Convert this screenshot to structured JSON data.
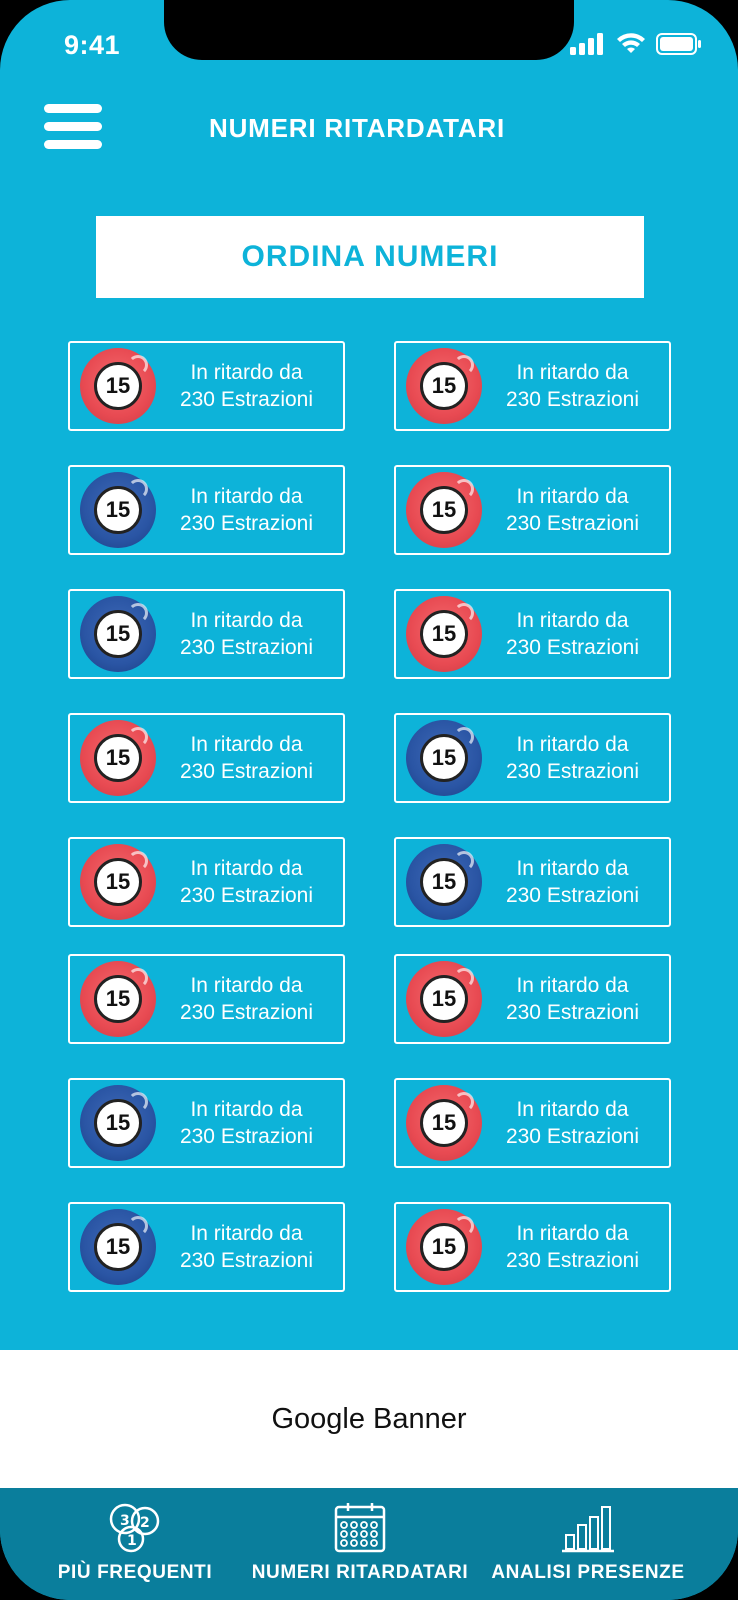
{
  "status_bar": {
    "time": "9:41"
  },
  "header": {
    "title": "NUMERI RITARDATARI"
  },
  "sort_button": {
    "label": "ORDINA NUMERI"
  },
  "cards": [
    {
      "number": "15",
      "line1": "In ritardo da",
      "line2": "230 Estrazioni",
      "ball_color": "#e84a52"
    },
    {
      "number": "15",
      "line1": "In ritardo da",
      "line2": "230 Estrazioni",
      "ball_color": "#e84a52"
    },
    {
      "number": "15",
      "line1": "In ritardo da",
      "line2": "230 Estrazioni",
      "ball_color": "#2a55a4"
    },
    {
      "number": "15",
      "line1": "In ritardo da",
      "line2": "230 Estrazioni",
      "ball_color": "#e84a52"
    },
    {
      "number": "15",
      "line1": "In ritardo da",
      "line2": "230 Estrazioni",
      "ball_color": "#2a55a4"
    },
    {
      "number": "15",
      "line1": "In ritardo da",
      "line2": "230 Estrazioni",
      "ball_color": "#e84a52"
    },
    {
      "number": "15",
      "line1": "In ritardo da",
      "line2": "230 Estrazioni",
      "ball_color": "#e84a52"
    },
    {
      "number": "15",
      "line1": "In ritardo da",
      "line2": "230 Estrazioni",
      "ball_color": "#2a55a4"
    },
    {
      "number": "15",
      "line1": "In ritardo da",
      "line2": "230 Estrazioni",
      "ball_color": "#e84a52"
    },
    {
      "number": "15",
      "line1": "In ritardo da",
      "line2": "230 Estrazioni",
      "ball_color": "#2a55a4"
    },
    {
      "number": "15",
      "line1": "In ritardo da",
      "line2": "230 Estrazioni",
      "ball_color": "#e84a52"
    },
    {
      "number": "15",
      "line1": "In ritardo da",
      "line2": "230 Estrazioni",
      "ball_color": "#e84a52"
    },
    {
      "number": "15",
      "line1": "In ritardo da",
      "line2": "230 Estrazioni",
      "ball_color": "#2a55a4"
    },
    {
      "number": "15",
      "line1": "In ritardo da",
      "line2": "230 Estrazioni",
      "ball_color": "#e84a52"
    },
    {
      "number": "15",
      "line1": "In ritardo da",
      "line2": "230 Estrazioni",
      "ball_color": "#2a55a4"
    },
    {
      "number": "15",
      "line1": "In ritardo da",
      "line2": "230 Estrazioni",
      "ball_color": "#e84a52"
    }
  ],
  "banner": {
    "label": "Google Banner"
  },
  "tabbar": {
    "tabs": [
      {
        "label": "PIÙ FREQUENTI",
        "icon": "speech-bubbles-numbers-icon"
      },
      {
        "label": "NUMERI RITARDATARI",
        "icon": "calendar-icon"
      },
      {
        "label": "ANALISI PRESENZE",
        "icon": "bar-chart-icon"
      }
    ]
  },
  "colors": {
    "background": "#0db3d9",
    "tabbar": "#0a7e9c",
    "red_ball": "#e84a52",
    "blue_ball": "#2a55a4"
  }
}
